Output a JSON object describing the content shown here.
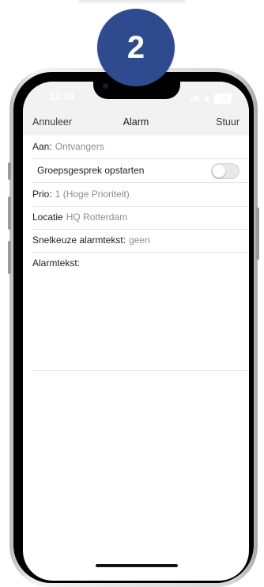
{
  "step": {
    "number": "2",
    "color": "#2f4b8f"
  },
  "status_bar": {
    "time": "12:34",
    "battery": "83"
  },
  "nav": {
    "left": "Annuleer",
    "title": "Alarm",
    "right": "Stuur"
  },
  "form": {
    "recipients": {
      "label": "Aan:",
      "value": "Ontvangers"
    },
    "group_chat": {
      "label": "Groepsgesprek opstarten",
      "enabled": false
    },
    "priority": {
      "label": "Prio:",
      "value": "1 (Hoge Prioriteit)"
    },
    "location": {
      "label": "Locatie",
      "value": "HQ Rotterdam"
    },
    "quick_text": {
      "label": "Snelkeuze alarmtekst:",
      "value": "geen"
    },
    "alarm_text": {
      "label": "Alarmtekst:",
      "value": ""
    }
  }
}
